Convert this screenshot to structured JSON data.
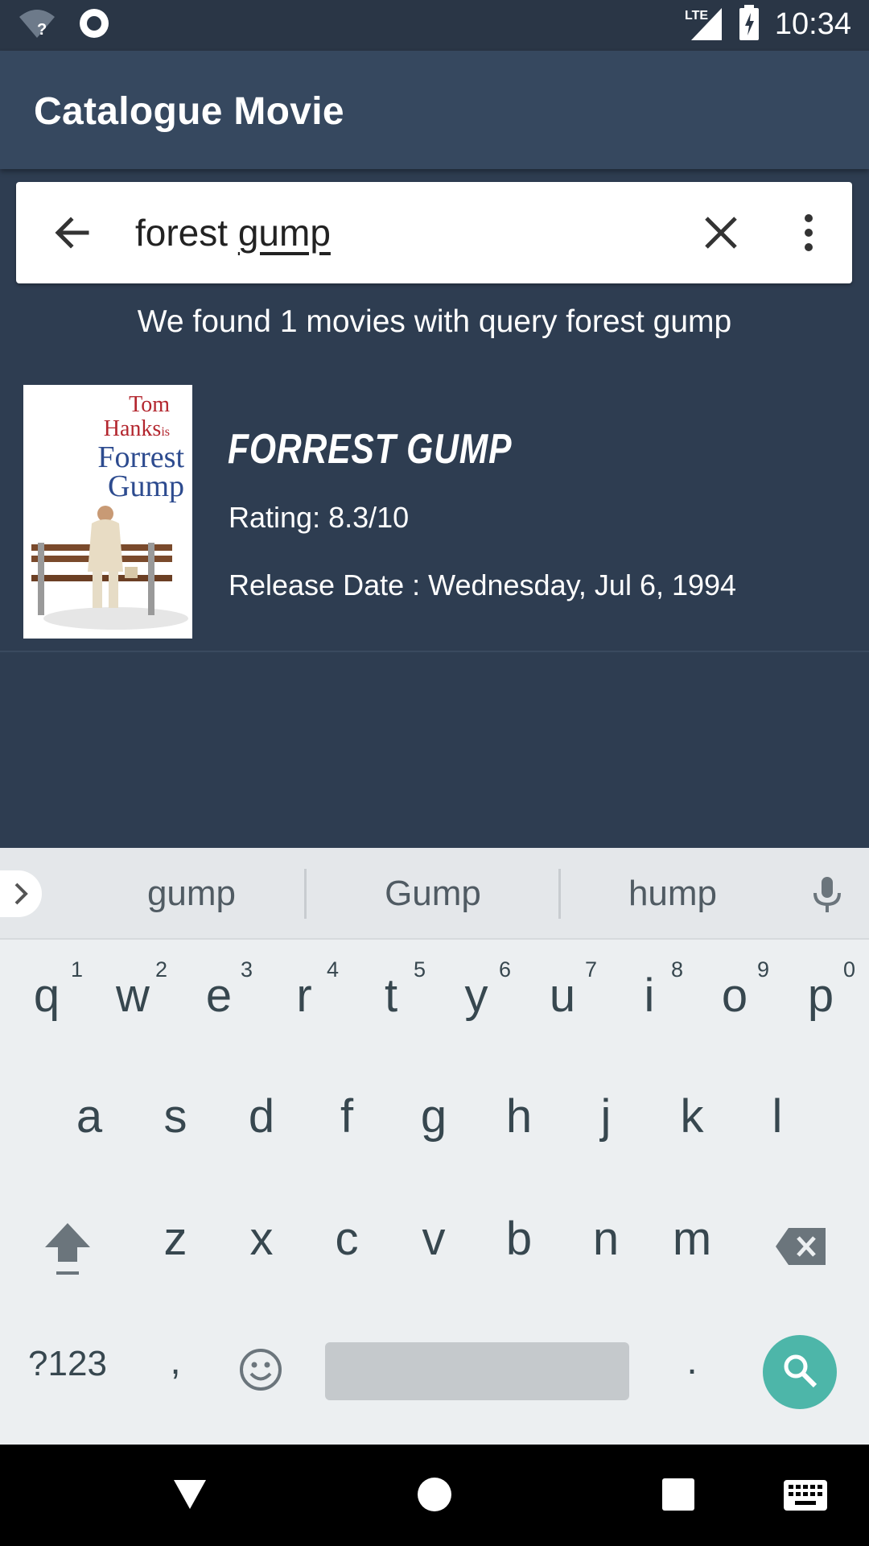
{
  "status_bar": {
    "time": "10:34",
    "network": "LTE",
    "icons": [
      "wifi-unknown-icon",
      "sync-circle-icon",
      "lte-signal-icon",
      "battery-charging-icon"
    ]
  },
  "app_bar": {
    "title": "Catalogue Movie"
  },
  "search": {
    "query_plain": "forest ",
    "query_underlined": "gump",
    "icons": [
      "back-arrow-icon",
      "clear-icon",
      "more-vert-icon"
    ]
  },
  "results": {
    "message": "We found 1 movies with query forest gump",
    "movies": [
      {
        "title": "FORREST GUMP",
        "rating": "Rating: 8.3/10",
        "release_date": "Release Date : Wednesday, Jul 6, 1994",
        "poster_text_1": "Tom",
        "poster_text_2": "Hanks",
        "poster_text_3": "is",
        "poster_text_4": "Forrest",
        "poster_text_5": "Gump"
      }
    ]
  },
  "keyboard": {
    "suggestions": [
      "gump",
      "Gump",
      "hump"
    ],
    "row1": [
      "q",
      "w",
      "e",
      "r",
      "t",
      "y",
      "u",
      "i",
      "o",
      "p"
    ],
    "row1_hints": [
      "1",
      "2",
      "3",
      "4",
      "5",
      "6",
      "7",
      "8",
      "9",
      "0"
    ],
    "row2": [
      "a",
      "s",
      "d",
      "f",
      "g",
      "h",
      "j",
      "k",
      "l"
    ],
    "row3": [
      "z",
      "x",
      "c",
      "v",
      "b",
      "n",
      "m"
    ],
    "symbols_key": "?123",
    "comma_key": ",",
    "period_key": ".",
    "accent_color": "#4db6a9"
  }
}
